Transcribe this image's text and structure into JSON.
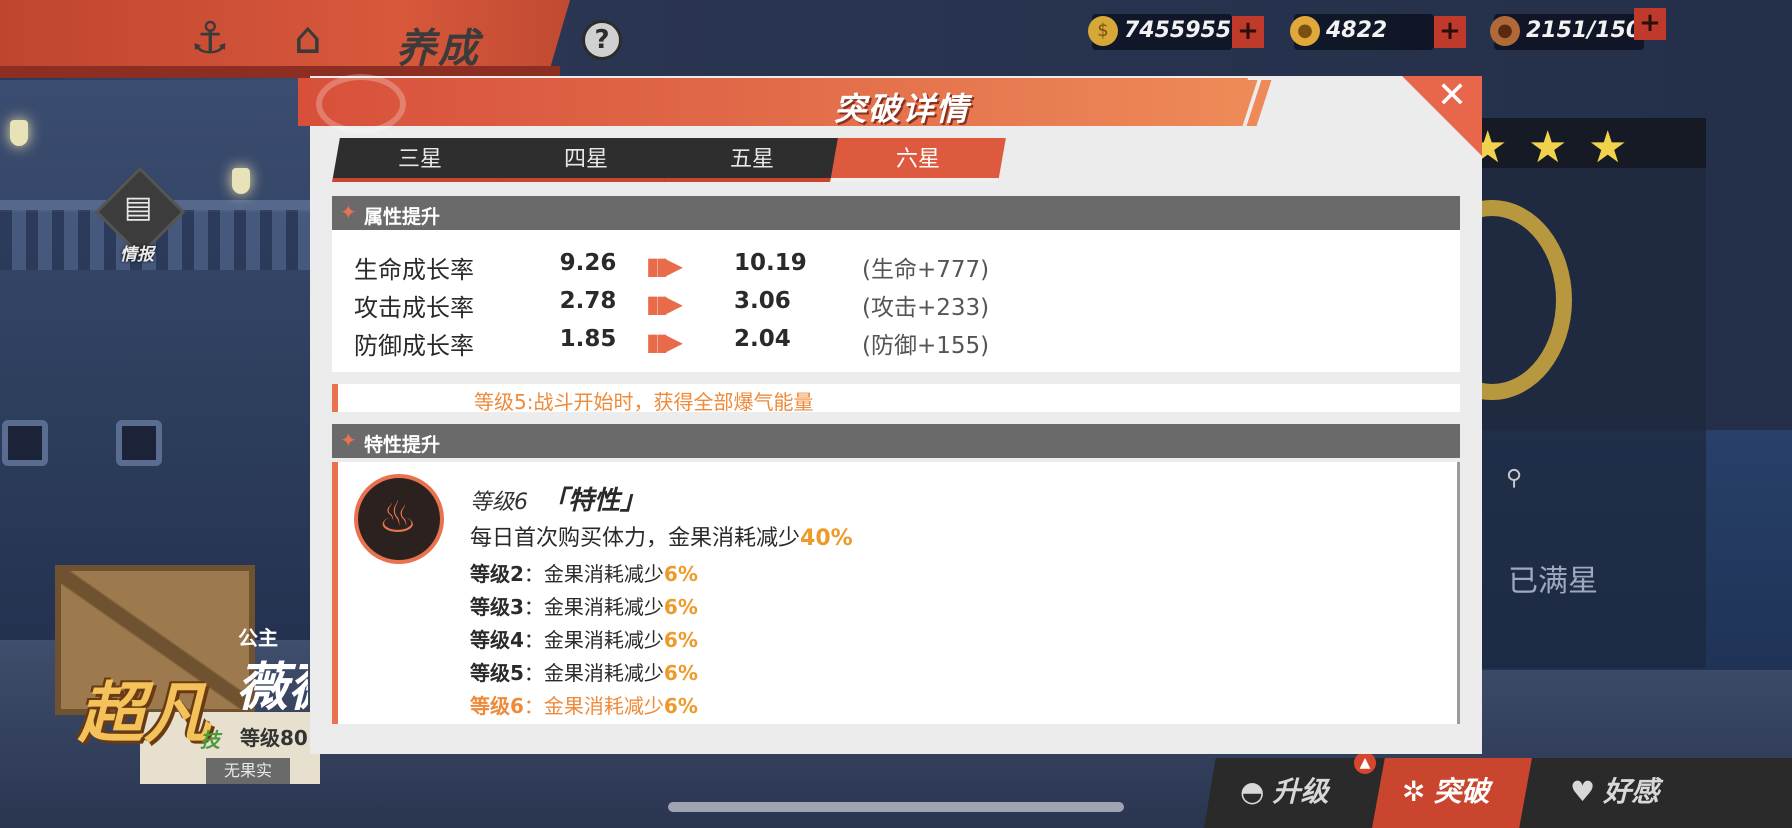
{
  "topbar": {
    "title": "养成",
    "help": "?",
    "resources": [
      {
        "icon": "gold-coin-icon",
        "value": "7455955"
      },
      {
        "icon": "gold-fruit-icon",
        "value": "4822"
      },
      {
        "icon": "meat-stamina-icon",
        "value": "2151/150"
      }
    ]
  },
  "side": {
    "info_label": "情报"
  },
  "character": {
    "rarity": "超凡",
    "title": "公主",
    "name": "薇薇",
    "skill_badge": "技",
    "level": "等级80",
    "fruit_tag": "无果实"
  },
  "right_panel": {
    "status": "已满星"
  },
  "bottom_tabs": [
    "升级",
    "突破",
    "好感"
  ],
  "modal": {
    "title": "突破详情",
    "star_tabs": [
      "三星",
      "四星",
      "五星",
      "六星"
    ],
    "active_tab": 3,
    "attr_section": "属性提升",
    "attributes": [
      {
        "name": "生命成长率",
        "from": "9.26",
        "to": "10.19",
        "bonus": "(生命+777)"
      },
      {
        "name": "攻击成长率",
        "from": "2.78",
        "to": "3.06",
        "bonus": "(攻击+233)"
      },
      {
        "name": "防御成长率",
        "from": "1.85",
        "to": "2.04",
        "bonus": "(防御+155)"
      }
    ],
    "prev_note": "等级5:战斗开始时，获得全部爆气能量",
    "trait_section": "特性提升",
    "trait": {
      "level": "等级6",
      "name": "「特性」",
      "desc_prefix": "每日首次购买体力，金果消耗减少",
      "desc_value": "40%",
      "lines": [
        {
          "level": "等级2",
          "text": "：金果消耗减少",
          "value": "6%"
        },
        {
          "level": "等级3",
          "text": "：金果消耗减少",
          "value": "6%"
        },
        {
          "level": "等级4",
          "text": "：金果消耗减少",
          "value": "6%"
        },
        {
          "level": "等级5",
          "text": "：金果消耗减少",
          "value": "6%"
        },
        {
          "level": "等级6",
          "text": "：金果消耗减少",
          "value": "6%"
        }
      ]
    }
  },
  "colors": {
    "accent": "#de5a3f",
    "highlight": "#ee9a2a",
    "section": "#6a6a6a"
  }
}
